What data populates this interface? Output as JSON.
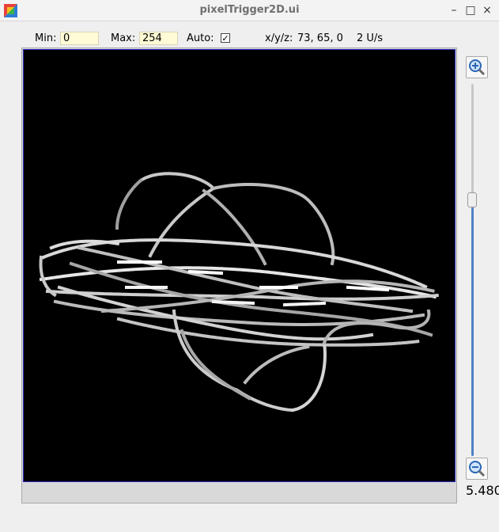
{
  "window": {
    "title": "pixelTrigger2D.ui",
    "app_icon": "colorful-app-icon",
    "controls": {
      "minimize": "–",
      "maximize": "□",
      "close": "×"
    }
  },
  "toolbar": {
    "min_label": "Min:",
    "min_value": "0",
    "max_label": "Max:",
    "max_value": "254",
    "auto_label": "Auto:",
    "auto_checked": "✓",
    "coords_label": "x/y/z:",
    "coords_value": "73, 65, 0",
    "rate": "2 U/s"
  },
  "zoom": {
    "in_icon": "zoom-in-icon",
    "out_icon": "zoom-out-icon",
    "value": "5.480",
    "slider_fraction": 0.67
  },
  "colors": {
    "canvas_background": "#000000",
    "field_background": "#fffbd6",
    "slider_fill": "#4d82c7"
  }
}
